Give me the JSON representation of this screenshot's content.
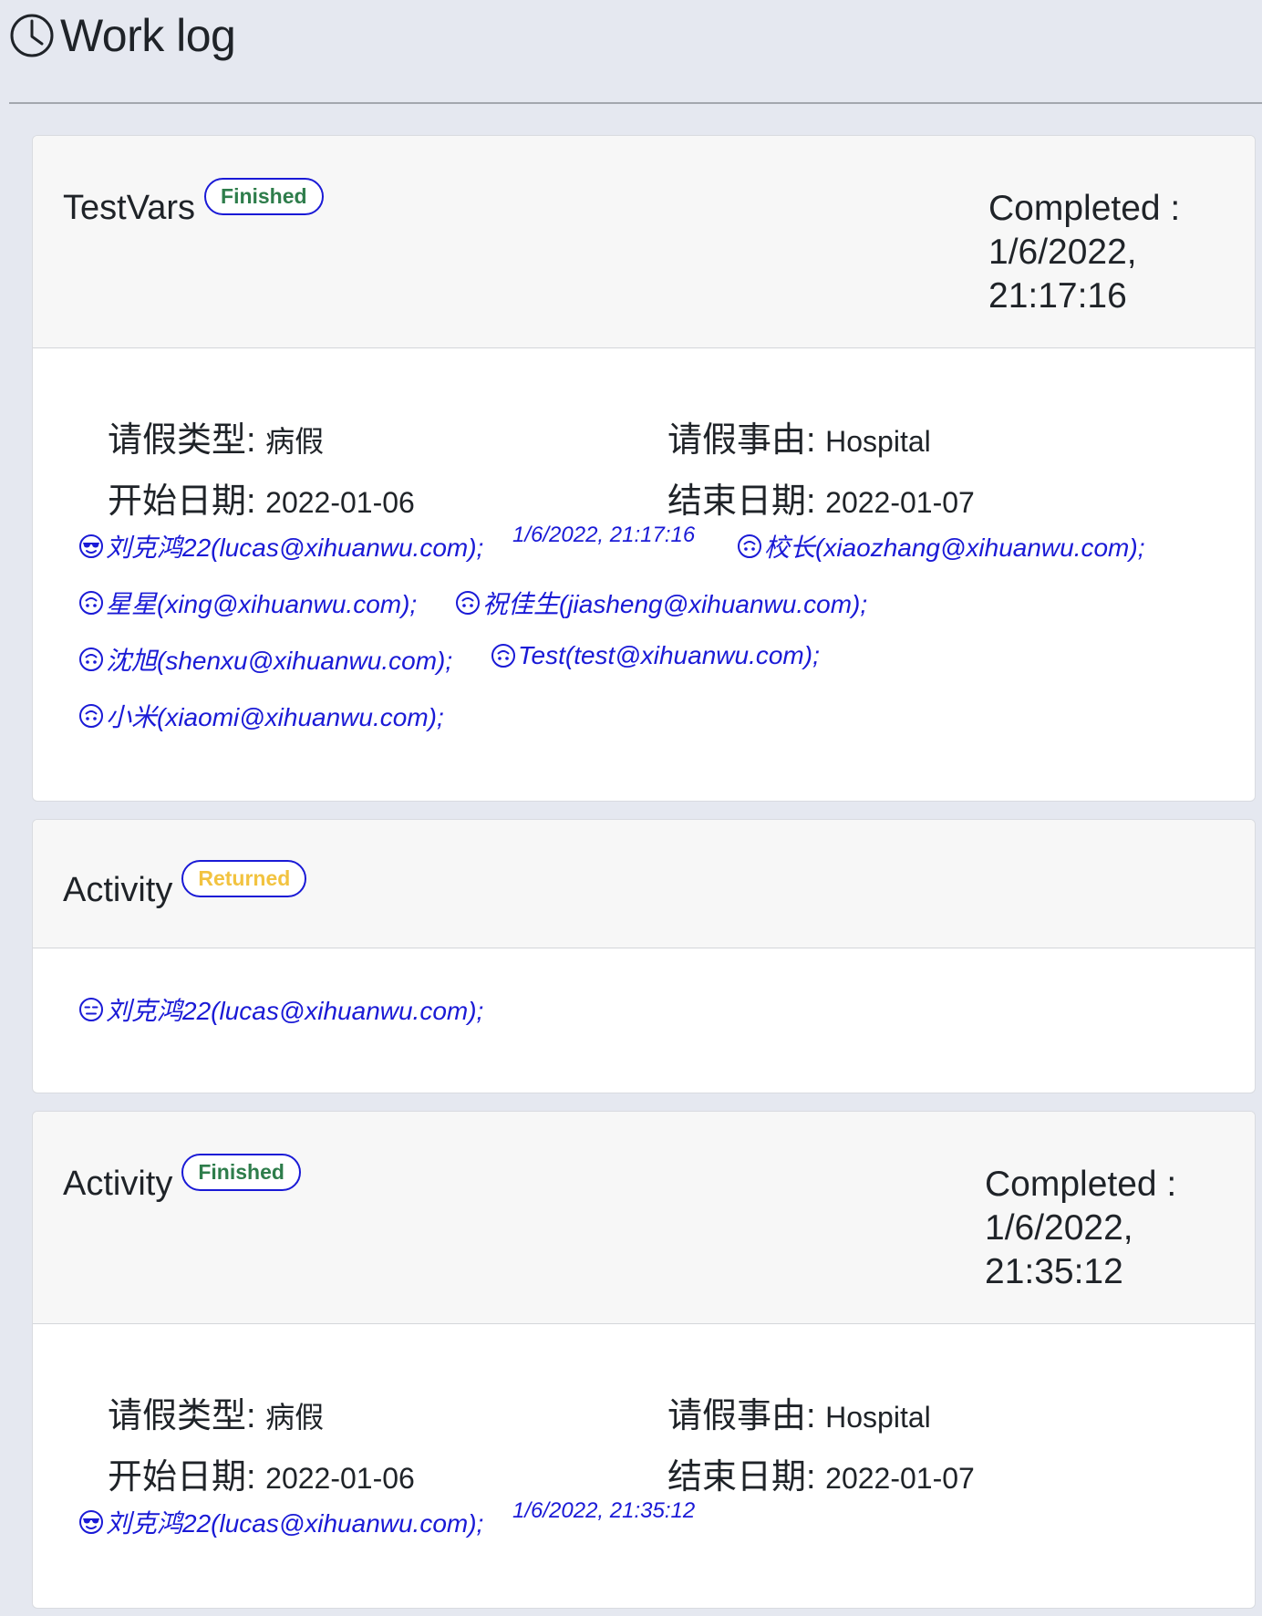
{
  "header": {
    "title": "Work log",
    "icon": "clock-icon"
  },
  "cards": [
    {
      "name": "TestVars",
      "status": "Finished",
      "completed_label": "Completed :",
      "completed_date": "1/6/2022,",
      "completed_time": "21:17:16",
      "fields": [
        {
          "label": "请假类型",
          "value": "病假"
        },
        {
          "label": "请假事由",
          "value": "Hospital"
        },
        {
          "label": "开始日期",
          "value": "2022-01-06"
        },
        {
          "label": "结束日期",
          "value": "2022-01-07"
        }
      ],
      "participants": [
        {
          "name": "刘克鸿22(lucas@xihuanwu.com);",
          "icon": "sunglasses-face-icon"
        },
        {
          "name": "校长(xiaozhang@xihuanwu.com);",
          "icon": "upside-down-face-icon"
        },
        {
          "name": "星星(xing@xihuanwu.com);",
          "icon": "upside-down-face-icon"
        },
        {
          "name": "祝佳生(jiasheng@xihuanwu.com);",
          "icon": "upside-down-face-icon"
        },
        {
          "name": "沈旭(shenxu@xihuanwu.com);",
          "icon": "upside-down-face-icon"
        },
        {
          "name": "Test(test@xihuanwu.com);",
          "icon": "upside-down-face-icon"
        },
        {
          "name": "小米(xiaomi@xihuanwu.com);",
          "icon": "upside-down-face-icon"
        }
      ],
      "timestamp": "1/6/2022, 21:17:16"
    },
    {
      "name": "Activity",
      "status": "Returned",
      "participants": [
        {
          "name": "刘克鸿22(lucas@xihuanwu.com);",
          "icon": "expressionless-face-icon"
        }
      ]
    },
    {
      "name": "Activity",
      "status": "Finished",
      "completed_label": "Completed :",
      "completed_date": "1/6/2022,",
      "completed_time": "21:35:12",
      "fields": [
        {
          "label": "请假类型",
          "value": "病假"
        },
        {
          "label": "请假事由",
          "value": "Hospital"
        },
        {
          "label": "开始日期",
          "value": "2022-01-06"
        },
        {
          "label": "结束日期",
          "value": "2022-01-07"
        }
      ],
      "participants": [
        {
          "name": "刘克鸿22(lucas@xihuanwu.com);",
          "icon": "sunglasses-face-icon"
        }
      ],
      "timestamp": "1/6/2022, 21:35:12"
    }
  ],
  "colors": {
    "link": "#1a1ad6",
    "finished": "#2e7d4b",
    "returned": "#f2c340",
    "background": "#e5e8f0"
  }
}
